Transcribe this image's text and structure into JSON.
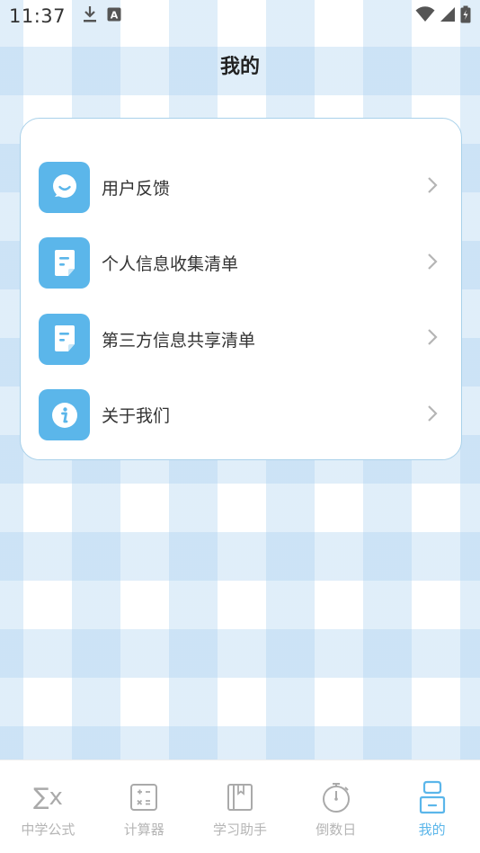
{
  "status_bar": {
    "time": "11:37",
    "left_icons": [
      "download-icon",
      "a-badge-icon"
    ],
    "right_icons": [
      "wifi-icon",
      "signal-icon",
      "battery-icon"
    ]
  },
  "page": {
    "title": "我的"
  },
  "menu": {
    "items": [
      {
        "label": "用户反馈",
        "icon": "chat-bubble-icon"
      },
      {
        "label": "个人信息收集清单",
        "icon": "document-icon"
      },
      {
        "label": "第三方信息共享清单",
        "icon": "document-icon"
      },
      {
        "label": "关于我们",
        "icon": "info-icon"
      }
    ]
  },
  "bottom_nav": {
    "items": [
      {
        "label": "中学公式",
        "icon": "sigma-icon",
        "icon_text": "∑x",
        "active": false
      },
      {
        "label": "计算器",
        "icon": "calculator-icon",
        "active": false
      },
      {
        "label": "学习助手",
        "icon": "book-icon",
        "active": false
      },
      {
        "label": "倒数日",
        "icon": "stopwatch-icon",
        "active": false
      },
      {
        "label": "我的",
        "icon": "profile-icon",
        "active": true
      }
    ]
  },
  "colors": {
    "accent": "#5bb6ea",
    "card_border": "#a9d1ea",
    "inactive_nav": "#b5b5b5",
    "checker_light": "#dfeefa"
  }
}
